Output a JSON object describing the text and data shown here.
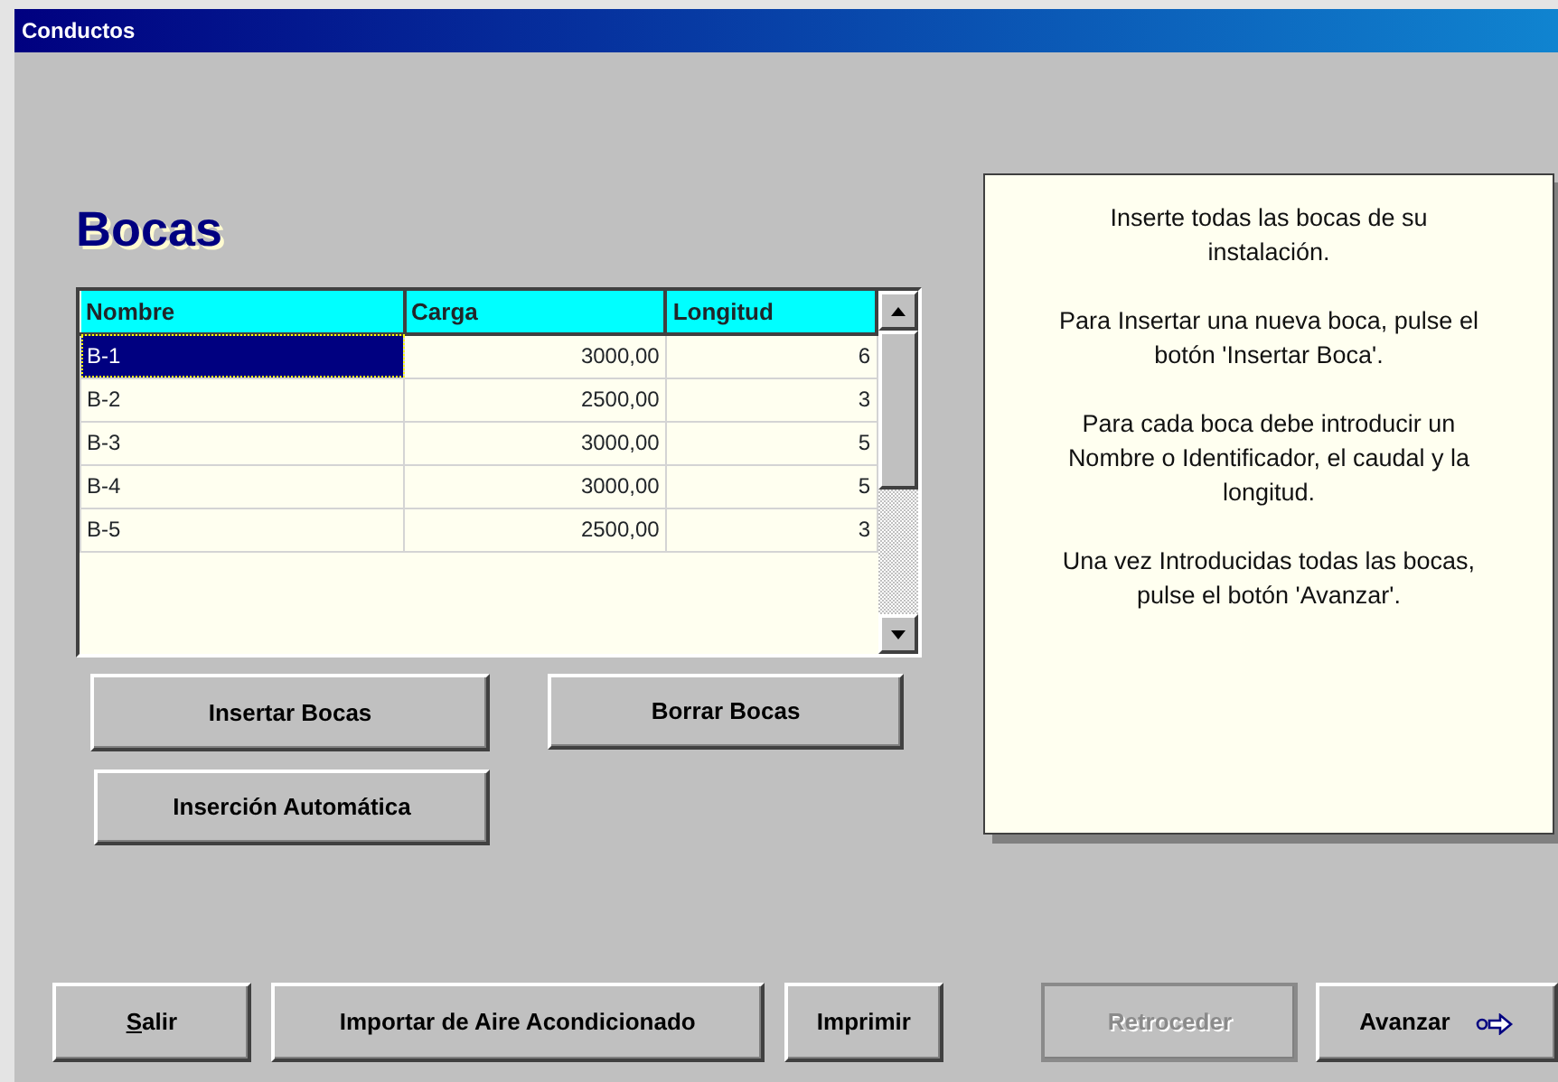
{
  "window": {
    "title": "Conductos"
  },
  "heading": "Bocas",
  "table": {
    "columns": [
      "Nombre",
      "Carga",
      "Longitud"
    ],
    "rows": [
      {
        "cells": [
          "B-1",
          "3000,00",
          "6"
        ],
        "selected": true
      },
      {
        "cells": [
          "B-2",
          "2500,00",
          "3"
        ],
        "selected": false
      },
      {
        "cells": [
          "B-3",
          "3000,00",
          "5"
        ],
        "selected": false
      },
      {
        "cells": [
          "B-4",
          "3000,00",
          "5"
        ],
        "selected": false
      },
      {
        "cells": [
          "B-5",
          "2500,00",
          "3"
        ],
        "selected": false
      }
    ]
  },
  "grid_buttons": [
    {
      "label": "Insertar Bocas"
    },
    {
      "label": "Borrar Bocas"
    },
    {
      "label": "Inserción Automática"
    }
  ],
  "help_text": [
    "Inserte todas las bocas de su instalación.",
    "Para Insertar una nueva boca, pulse el botón 'Insertar Boca'.",
    "Para cada boca debe introducir un Nombre o Identificador, el caudal y la longitud.",
    "Una vez Introducidas todas las bocas, pulse el botón 'Avanzar'."
  ],
  "footer_buttons": [
    {
      "label": "Salir",
      "disabled": false,
      "underline_first": true
    },
    {
      "label": "Importar de Aire Acondicionado",
      "disabled": false,
      "underline_first": false
    },
    {
      "label": "Imprimir",
      "disabled": false,
      "underline_first": false
    },
    {
      "label": "Retroceder",
      "disabled": true,
      "underline_first": false
    },
    {
      "label": "Avanzar",
      "disabled": false,
      "underline_first": false,
      "kind": "next"
    }
  ]
}
